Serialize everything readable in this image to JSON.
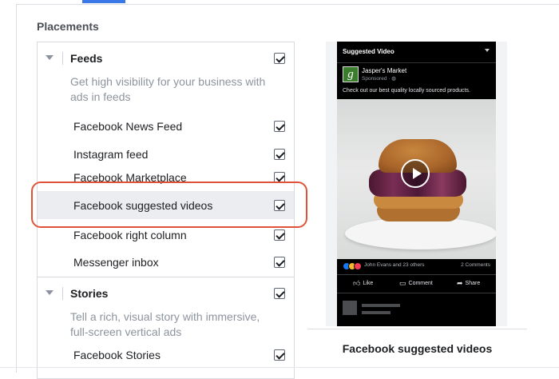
{
  "section": {
    "title": "Placements"
  },
  "groups": {
    "feeds": {
      "label": "Feeds",
      "description": "Get high visibility for your business with ads in feeds",
      "items": [
        {
          "label": "Facebook News Feed",
          "checked": true
        },
        {
          "label": "Instagram feed",
          "checked": true
        },
        {
          "label": "Facebook Marketplace",
          "checked": true
        },
        {
          "label": "Facebook suggested videos",
          "checked": true,
          "highlighted": true
        },
        {
          "label": "Facebook right column",
          "checked": true
        },
        {
          "label": "Messenger inbox",
          "checked": true
        }
      ]
    },
    "stories": {
      "label": "Stories",
      "description": "Tell a rich, visual story with immersive, full-screen vertical ads",
      "items": [
        {
          "label": "Facebook Stories",
          "checked": true
        }
      ]
    }
  },
  "preview": {
    "header_title": "Suggested Video",
    "page_name": "Jasper's Market",
    "sponsored": "Sponsored · ",
    "logo_letter": "g",
    "ad_text": "Check out our best quality locally sourced products.",
    "reactions_text": "John Evans and 23 others",
    "comments_text": "2 Comments",
    "actions": {
      "like": "Like",
      "comment": "Comment",
      "share": "Share"
    },
    "caption": "Facebook suggested videos"
  },
  "colors": {
    "accent": "#3b78e7",
    "annotation": "#e0533a",
    "highlight_row": "#ebedf0",
    "logo_green": "#3a7d2c"
  },
  "icons": [
    "chevron-down-icon",
    "checkbox-checked-icon",
    "play-icon",
    "like-icon",
    "comment-icon",
    "share-icon",
    "globe-icon"
  ]
}
